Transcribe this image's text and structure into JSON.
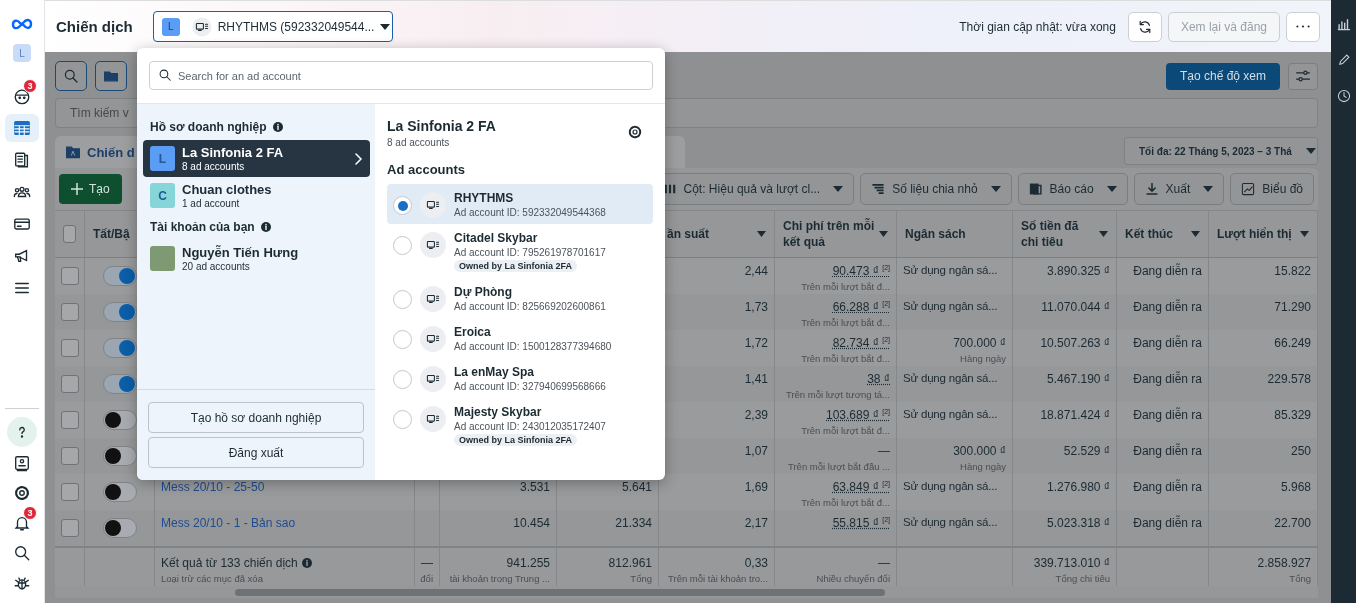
{
  "nav_rail": {
    "avatar": "L",
    "items": [
      {
        "selected": false,
        "badge": "3"
      },
      {
        "selected": true
      },
      {
        "selected": false
      },
      {
        "selected": false
      },
      {
        "selected": false
      },
      {
        "selected": false
      },
      {
        "selected": false
      }
    ],
    "bottom_items": [
      {
        "selected": false
      },
      {
        "selected": false
      },
      {
        "selected": false
      },
      {
        "selected": false,
        "badge": "3"
      },
      {
        "selected": false
      },
      {
        "selected": false
      }
    ]
  },
  "header": {
    "title": "Chiến dịch",
    "account_selector": {
      "avatar": "L",
      "label": "RHYTHMS (592332049544..."
    },
    "update_status": "Thời gian cập nhật: vừa xong",
    "review_button": {
      "label": "Xem lại và đăng",
      "disabled": true
    }
  },
  "toolbar": {
    "create_view_button": "Tạo chế độ xem",
    "search_placeholder": "Tìm kiếm v"
  },
  "tabs": [
    {
      "label": "Chiến d",
      "selected": true
    }
  ],
  "date_range": "Tối đa: 22 Tháng 5, 2023 – 3 Thá",
  "actions": {
    "create": "Tạo",
    "buttons": [
      {
        "label": "Cột: Hiệu quả và lượt cl...",
        "caret": true
      },
      {
        "label": "Số liệu chia nhỏ",
        "caret": true
      },
      {
        "label": "Báo cáo",
        "caret": true
      },
      {
        "label": "Xuất",
        "caret": true
      },
      {
        "label": "Biểu đồ",
        "caret": false
      }
    ]
  },
  "table": {
    "header_checked": false,
    "columns": [
      {
        "label": "Tất/Bậ"
      },
      {
        "label": "ần suất",
        "sort": true
      },
      {
        "label": "Chi phí trên mỗi kết quả",
        "sort": true
      },
      {
        "label": "Ngân sách",
        "sort": false
      },
      {
        "label": "Số tiền đã chi tiêu",
        "sort": true
      },
      {
        "label": "Kết thúc",
        "sort": true
      },
      {
        "label": "Lượt hiển thị",
        "sort": true
      }
    ],
    "rows": [
      {
        "checked": false,
        "on": true,
        "frequency": "2,44",
        "cost": {
          "value": "90.473 ₫ $^{[2]}$",
          "note": "Trên mỗi lượt bắt đ..."
        },
        "budget": {
          "kind": "text",
          "value": "Sử dụng ngân sá..."
        },
        "spent": "3.890.325 ₫",
        "end": "Đang diễn ra",
        "impressions": "15.822"
      },
      {
        "checked": false,
        "on": true,
        "frequency": "1,73",
        "cost": {
          "value": "66.288 ₫ $^{[2]}$",
          "note": "Trên mỗi lượt bắt đ..."
        },
        "budget": {
          "kind": "text",
          "value": "Sử dụng ngân sá..."
        },
        "spent": "11.070.044 ₫",
        "end": "Đang diễn ra",
        "impressions": "71.290"
      },
      {
        "checked": false,
        "on": true,
        "frequency": "1,72",
        "cost": {
          "value": "82.734 ₫ $^{[2]}$",
          "note": "Trên mỗi lượt bắt đ..."
        },
        "budget": {
          "kind": "amount",
          "value": "700.000 ₫",
          "note": "Hàng ngày"
        },
        "spent": "10.507.263 ₫",
        "end": "Đang diễn ra",
        "impressions": "66.249"
      },
      {
        "checked": false,
        "on": true,
        "frequency": "1,41",
        "cost": {
          "value": "38 ₫",
          "note": "Trên mỗi lượt tương tá..."
        },
        "budget": {
          "kind": "text",
          "value": "Sử dụng ngân sá..."
        },
        "spent": "5.467.190 ₫",
        "end": "Đang diễn ra",
        "impressions": "229.578"
      },
      {
        "checked": false,
        "on": false,
        "frequency": "2,39",
        "cost": {
          "value": "103.689 ₫ $^{[2]}$",
          "note": "Trên mỗi lượt bắt đ..."
        },
        "budget": {
          "kind": "text",
          "value": "Sử dụng ngân sá..."
        },
        "spent": "18.871.424 ₫",
        "end": "Đang diễn ra",
        "impressions": "85.329"
      },
      {
        "checked": false,
        "on": false,
        "frequency": "1,07",
        "cost": {
          "value": "—",
          "note": "Trên mỗi lượt bắt đầu ..."
        },
        "budget": {
          "kind": "amount",
          "value": "300.000 ₫",
          "note": "Hàng ngày"
        },
        "spent": "52.529 ₫",
        "end": "Đang diễn ra",
        "impressions": "250"
      },
      {
        "checked": false,
        "on": false,
        "name": "Mess 20/10 - 25-50",
        "col_b": "3.531",
        "col_c": "5.641",
        "frequency": "1,69",
        "cost": {
          "value": "63.849 ₫ $^{[2]}$",
          "note": "Trên mỗi lượt bắt đ..."
        },
        "budget": {
          "kind": "text",
          "value": "Sử dụng ngân sá..."
        },
        "spent": "1.276.980 ₫",
        "end": "Đang diễn ra",
        "impressions": "5.968"
      },
      {
        "checked": false,
        "on": false,
        "name": "Mess 20/10 - 1 - Bản sao",
        "col_b": "10.454",
        "col_c": "21.334",
        "frequency": "2,17",
        "cost": {
          "value": "55.815 ₫ $^{[2]}$"
        },
        "budget": {
          "kind": "text",
          "value": "Sử dụng ngân sá..."
        },
        "spent": "5.023.318 ₫",
        "end": "Đang diễn ra",
        "impressions": "22.700"
      }
    ],
    "totals": {
      "name": {
        "value": "Kết quả từ 133 chiến dịch",
        "note": "Loại trừ các mục đã xóa"
      },
      "col_a": {
        "value": "—",
        "note": "đổi"
      },
      "col_b": {
        "value": "941.255",
        "note": "tài khoản trong Trung ..."
      },
      "col_c": {
        "value": "812.961",
        "note": "Tổng"
      },
      "frequency": {
        "value": "0,33",
        "note": "Trên mỗi tài khoản tro..."
      },
      "cost": {
        "value": "—",
        "note": "Nhiều chuyển đổi"
      },
      "spent": {
        "value": "339.713.010 ₫",
        "note": "Tổng chi tiêu"
      },
      "impressions": {
        "value": "2.858.927",
        "note": "Tổng"
      }
    }
  },
  "account_menu": {
    "search_placeholder": "Search for an ad account",
    "business_heading": "Hồ sơ doanh nghiệp",
    "businesses": [
      {
        "avatar": "L",
        "name": "La Sinfonia 2 FA",
        "count": "8 ad accounts",
        "selected": true,
        "color": "#5b9cf5"
      },
      {
        "avatar": "C",
        "name": "Chuan clothes",
        "count": "1 ad account",
        "selected": false,
        "color": "#86d5d8"
      }
    ],
    "personal_heading": "Tài khoản của bạn",
    "personal": [
      {
        "name": "Nguyễn Tiến Hưng",
        "count": "20 ad accounts",
        "selected": false
      }
    ],
    "buttons": [
      "Tạo hồ sơ doanh nghiệp",
      "Đăng xuất"
    ],
    "detail": {
      "title": "La Sinfonia 2 FA",
      "count": "8 ad accounts",
      "heading": "Ad accounts",
      "accounts": [
        {
          "name": "RHYTHMS",
          "id": "Ad account ID: 592332049544368",
          "selected": true
        },
        {
          "name": "Citadel Skybar",
          "id": "Ad account ID: 795261978701617",
          "owner": "Owned by La Sinfonia 2FA",
          "selected": false
        },
        {
          "name": "Dự Phòng",
          "id": "Ad account ID: 825669202600861",
          "selected": false
        },
        {
          "name": "Eroica",
          "id": "Ad account ID: 1500128377394680",
          "selected": false
        },
        {
          "name": "La enMay Spa",
          "id": "Ad account ID: 327940699568666",
          "selected": false
        },
        {
          "name": "Majesty Skybar",
          "id": "Ad account ID: 243012035172407",
          "owner": "Owned by La Sinfonia 2FA",
          "selected": false
        }
      ]
    }
  }
}
